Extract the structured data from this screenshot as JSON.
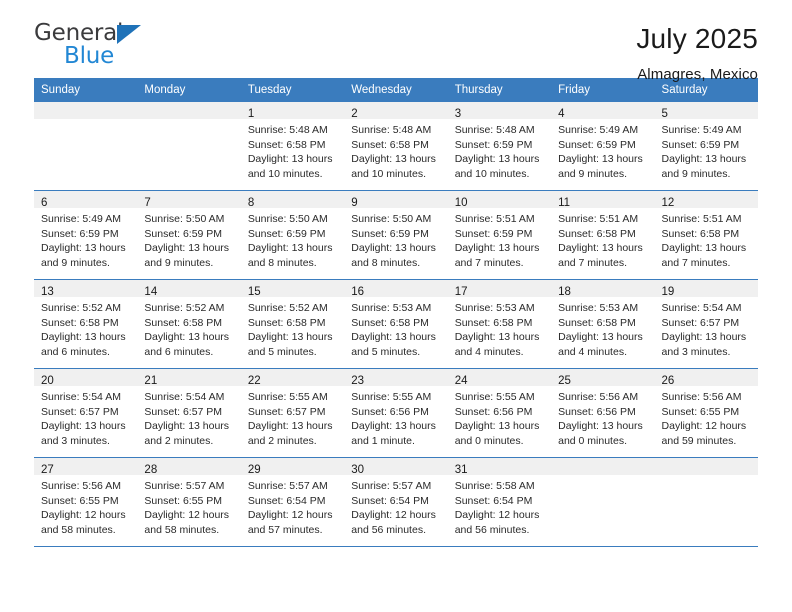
{
  "brand": {
    "name_top": "General",
    "name_bottom": "Blue",
    "triangle_color": "#1f72b8",
    "blue_color": "#2287d4"
  },
  "header": {
    "title": "July 2025",
    "subtitle": "Almagres, Mexico"
  },
  "theme": {
    "header_blue": "#3a7cbe",
    "daynum_band": "#f0f0f0",
    "text": "#1a1a1a"
  },
  "weekday_headers": [
    "Sunday",
    "Monday",
    "Tuesday",
    "Wednesday",
    "Thursday",
    "Friday",
    "Saturday"
  ],
  "labels": {
    "sunrise_prefix": "Sunrise:",
    "sunset_prefix": "Sunset:",
    "daylight_prefix": "Daylight:"
  },
  "weeks": [
    [
      {
        "day": "",
        "sunrise": "",
        "sunset": "",
        "daylight1": "",
        "daylight2": ""
      },
      {
        "day": "",
        "sunrise": "",
        "sunset": "",
        "daylight1": "",
        "daylight2": ""
      },
      {
        "day": "1",
        "sunrise": "Sunrise: 5:48 AM",
        "sunset": "Sunset: 6:58 PM",
        "daylight1": "Daylight: 13 hours",
        "daylight2": "and 10 minutes."
      },
      {
        "day": "2",
        "sunrise": "Sunrise: 5:48 AM",
        "sunset": "Sunset: 6:58 PM",
        "daylight1": "Daylight: 13 hours",
        "daylight2": "and 10 minutes."
      },
      {
        "day": "3",
        "sunrise": "Sunrise: 5:48 AM",
        "sunset": "Sunset: 6:59 PM",
        "daylight1": "Daylight: 13 hours",
        "daylight2": "and 10 minutes."
      },
      {
        "day": "4",
        "sunrise": "Sunrise: 5:49 AM",
        "sunset": "Sunset: 6:59 PM",
        "daylight1": "Daylight: 13 hours",
        "daylight2": "and 9 minutes."
      },
      {
        "day": "5",
        "sunrise": "Sunrise: 5:49 AM",
        "sunset": "Sunset: 6:59 PM",
        "daylight1": "Daylight: 13 hours",
        "daylight2": "and 9 minutes."
      }
    ],
    [
      {
        "day": "6",
        "sunrise": "Sunrise: 5:49 AM",
        "sunset": "Sunset: 6:59 PM",
        "daylight1": "Daylight: 13 hours",
        "daylight2": "and 9 minutes."
      },
      {
        "day": "7",
        "sunrise": "Sunrise: 5:50 AM",
        "sunset": "Sunset: 6:59 PM",
        "daylight1": "Daylight: 13 hours",
        "daylight2": "and 9 minutes."
      },
      {
        "day": "8",
        "sunrise": "Sunrise: 5:50 AM",
        "sunset": "Sunset: 6:59 PM",
        "daylight1": "Daylight: 13 hours",
        "daylight2": "and 8 minutes."
      },
      {
        "day": "9",
        "sunrise": "Sunrise: 5:50 AM",
        "sunset": "Sunset: 6:59 PM",
        "daylight1": "Daylight: 13 hours",
        "daylight2": "and 8 minutes."
      },
      {
        "day": "10",
        "sunrise": "Sunrise: 5:51 AM",
        "sunset": "Sunset: 6:59 PM",
        "daylight1": "Daylight: 13 hours",
        "daylight2": "and 7 minutes."
      },
      {
        "day": "11",
        "sunrise": "Sunrise: 5:51 AM",
        "sunset": "Sunset: 6:58 PM",
        "daylight1": "Daylight: 13 hours",
        "daylight2": "and 7 minutes."
      },
      {
        "day": "12",
        "sunrise": "Sunrise: 5:51 AM",
        "sunset": "Sunset: 6:58 PM",
        "daylight1": "Daylight: 13 hours",
        "daylight2": "and 7 minutes."
      }
    ],
    [
      {
        "day": "13",
        "sunrise": "Sunrise: 5:52 AM",
        "sunset": "Sunset: 6:58 PM",
        "daylight1": "Daylight: 13 hours",
        "daylight2": "and 6 minutes."
      },
      {
        "day": "14",
        "sunrise": "Sunrise: 5:52 AM",
        "sunset": "Sunset: 6:58 PM",
        "daylight1": "Daylight: 13 hours",
        "daylight2": "and 6 minutes."
      },
      {
        "day": "15",
        "sunrise": "Sunrise: 5:52 AM",
        "sunset": "Sunset: 6:58 PM",
        "daylight1": "Daylight: 13 hours",
        "daylight2": "and 5 minutes."
      },
      {
        "day": "16",
        "sunrise": "Sunrise: 5:53 AM",
        "sunset": "Sunset: 6:58 PM",
        "daylight1": "Daylight: 13 hours",
        "daylight2": "and 5 minutes."
      },
      {
        "day": "17",
        "sunrise": "Sunrise: 5:53 AM",
        "sunset": "Sunset: 6:58 PM",
        "daylight1": "Daylight: 13 hours",
        "daylight2": "and 4 minutes."
      },
      {
        "day": "18",
        "sunrise": "Sunrise: 5:53 AM",
        "sunset": "Sunset: 6:58 PM",
        "daylight1": "Daylight: 13 hours",
        "daylight2": "and 4 minutes."
      },
      {
        "day": "19",
        "sunrise": "Sunrise: 5:54 AM",
        "sunset": "Sunset: 6:57 PM",
        "daylight1": "Daylight: 13 hours",
        "daylight2": "and 3 minutes."
      }
    ],
    [
      {
        "day": "20",
        "sunrise": "Sunrise: 5:54 AM",
        "sunset": "Sunset: 6:57 PM",
        "daylight1": "Daylight: 13 hours",
        "daylight2": "and 3 minutes."
      },
      {
        "day": "21",
        "sunrise": "Sunrise: 5:54 AM",
        "sunset": "Sunset: 6:57 PM",
        "daylight1": "Daylight: 13 hours",
        "daylight2": "and 2 minutes."
      },
      {
        "day": "22",
        "sunrise": "Sunrise: 5:55 AM",
        "sunset": "Sunset: 6:57 PM",
        "daylight1": "Daylight: 13 hours",
        "daylight2": "and 2 minutes."
      },
      {
        "day": "23",
        "sunrise": "Sunrise: 5:55 AM",
        "sunset": "Sunset: 6:56 PM",
        "daylight1": "Daylight: 13 hours",
        "daylight2": "and 1 minute."
      },
      {
        "day": "24",
        "sunrise": "Sunrise: 5:55 AM",
        "sunset": "Sunset: 6:56 PM",
        "daylight1": "Daylight: 13 hours",
        "daylight2": "and 0 minutes."
      },
      {
        "day": "25",
        "sunrise": "Sunrise: 5:56 AM",
        "sunset": "Sunset: 6:56 PM",
        "daylight1": "Daylight: 13 hours",
        "daylight2": "and 0 minutes."
      },
      {
        "day": "26",
        "sunrise": "Sunrise: 5:56 AM",
        "sunset": "Sunset: 6:55 PM",
        "daylight1": "Daylight: 12 hours",
        "daylight2": "and 59 minutes."
      }
    ],
    [
      {
        "day": "27",
        "sunrise": "Sunrise: 5:56 AM",
        "sunset": "Sunset: 6:55 PM",
        "daylight1": "Daylight: 12 hours",
        "daylight2": "and 58 minutes."
      },
      {
        "day": "28",
        "sunrise": "Sunrise: 5:57 AM",
        "sunset": "Sunset: 6:55 PM",
        "daylight1": "Daylight: 12 hours",
        "daylight2": "and 58 minutes."
      },
      {
        "day": "29",
        "sunrise": "Sunrise: 5:57 AM",
        "sunset": "Sunset: 6:54 PM",
        "daylight1": "Daylight: 12 hours",
        "daylight2": "and 57 minutes."
      },
      {
        "day": "30",
        "sunrise": "Sunrise: 5:57 AM",
        "sunset": "Sunset: 6:54 PM",
        "daylight1": "Daylight: 12 hours",
        "daylight2": "and 56 minutes."
      },
      {
        "day": "31",
        "sunrise": "Sunrise: 5:58 AM",
        "sunset": "Sunset: 6:54 PM",
        "daylight1": "Daylight: 12 hours",
        "daylight2": "and 56 minutes."
      },
      {
        "day": "",
        "sunrise": "",
        "sunset": "",
        "daylight1": "",
        "daylight2": ""
      },
      {
        "day": "",
        "sunrise": "",
        "sunset": "",
        "daylight1": "",
        "daylight2": ""
      }
    ]
  ]
}
